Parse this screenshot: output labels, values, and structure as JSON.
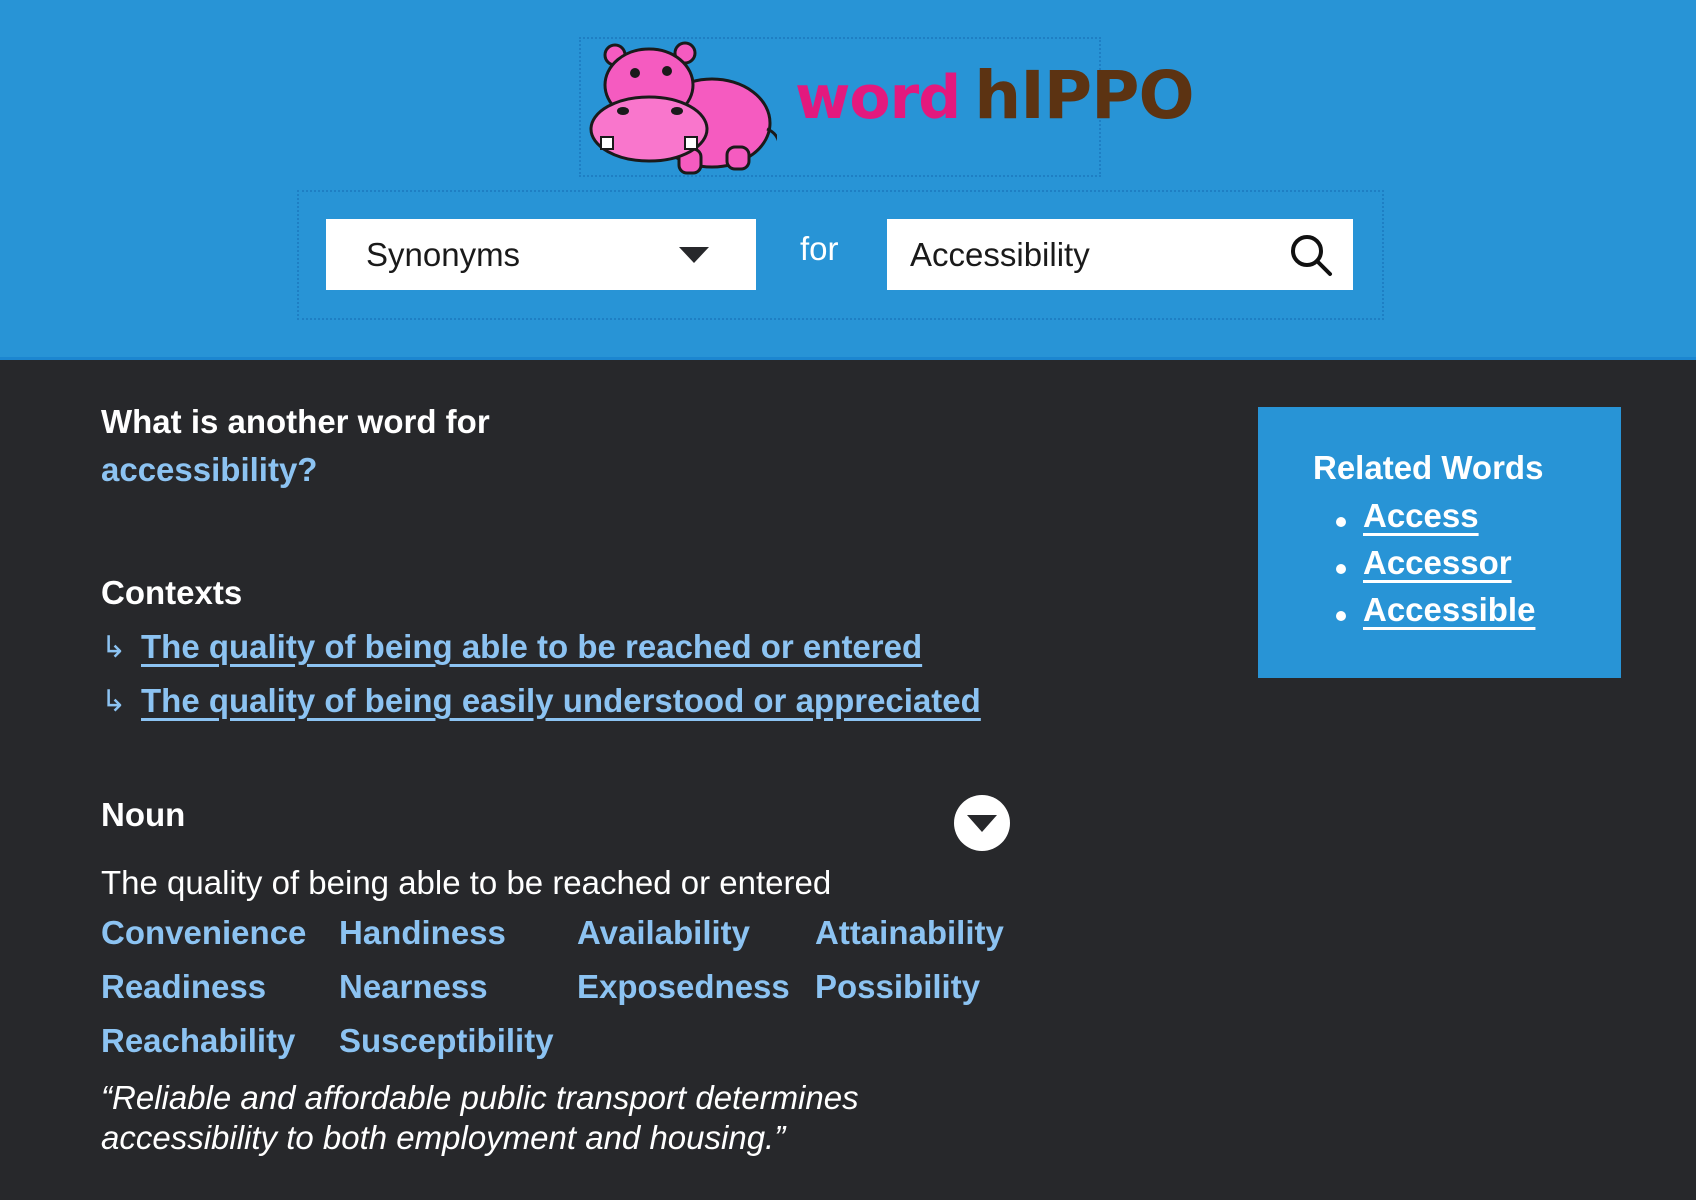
{
  "header": {
    "brand": {
      "word": "word",
      "hippo": "hIPPO"
    },
    "search": {
      "mode_selected": "Synonyms",
      "for_label": "for",
      "term_value": "Accessibility"
    }
  },
  "main": {
    "question": {
      "prefix": "What is another word for",
      "term": "accessibility?"
    },
    "contexts": {
      "title": "Contexts",
      "items": [
        {
          "arrow": "↳",
          "label": "The quality of being able to be reached or entered"
        },
        {
          "arrow": "↳",
          "label": "The quality of being easily understood or appreciated"
        }
      ]
    },
    "noun": {
      "title": "Noun",
      "definition": "The quality of being able to be reached or entered",
      "synonyms": [
        "Convenience",
        "Handiness",
        "Availability",
        "Attainability",
        "Readiness",
        "Nearness",
        "Exposedness",
        "Possibility",
        "Reachability",
        "Susceptibility"
      ],
      "example": "“Reliable and affordable public transport determines accessibility to both employment and housing.”"
    }
  },
  "related": {
    "title": "Related Words",
    "items": [
      "Access",
      "Accessor",
      "Accessible"
    ]
  },
  "colors": {
    "header_bg": "#2894d6",
    "page_bg": "#27282b",
    "link": "#8cc3f2",
    "brand_pink": "#e3197e",
    "brand_brown": "#5c3312"
  }
}
